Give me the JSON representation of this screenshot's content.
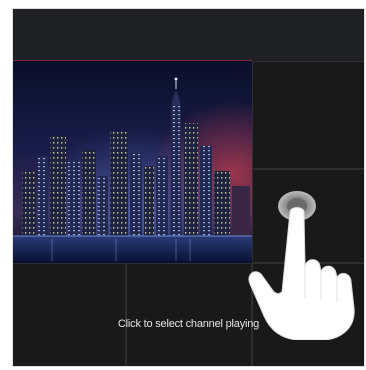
{
  "player": {
    "caption": "Click to select channel playing"
  },
  "icons": {
    "gesture": "tap-hand-icon"
  },
  "colors": {
    "background": "#1b1b1b",
    "accent": "#7a2a33",
    "caption": "#e6e6e6"
  }
}
